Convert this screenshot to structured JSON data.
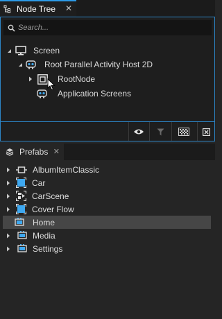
{
  "node_tree": {
    "tab_label": "Node Tree",
    "search_placeholder": "Search...",
    "items": [
      {
        "label": "Screen",
        "icon": "screen-icon"
      },
      {
        "label": "Root Parallel Activity Host 2D",
        "icon": "activity-host-icon"
      },
      {
        "label": "RootNode",
        "icon": "node-icon"
      },
      {
        "label": "Application Screens",
        "icon": "activity-host-icon"
      }
    ],
    "toolbar_icons": [
      "eye-icon",
      "filter-icon",
      "checker-icon",
      "fit-icon"
    ]
  },
  "prefabs": {
    "tab_label": "Prefabs",
    "items": [
      {
        "label": "AlbumItemClassic",
        "icon": "album-item-icon",
        "expandable": true
      },
      {
        "label": "Car",
        "icon": "viewport-icon",
        "expandable": true
      },
      {
        "label": "CarScene",
        "icon": "scene-icon",
        "expandable": true
      },
      {
        "label": "Cover Flow",
        "icon": "viewport-icon",
        "expandable": true
      },
      {
        "label": "Home",
        "icon": "activity-icon",
        "expandable": false,
        "selected": true
      },
      {
        "label": "Media",
        "icon": "activity-icon",
        "expandable": true
      },
      {
        "label": "Settings",
        "icon": "activity-icon",
        "expandable": true
      }
    ]
  },
  "colors": {
    "accent": "#2c86c8",
    "icon_blue": "#3ea8f0",
    "selection": "#464646"
  }
}
